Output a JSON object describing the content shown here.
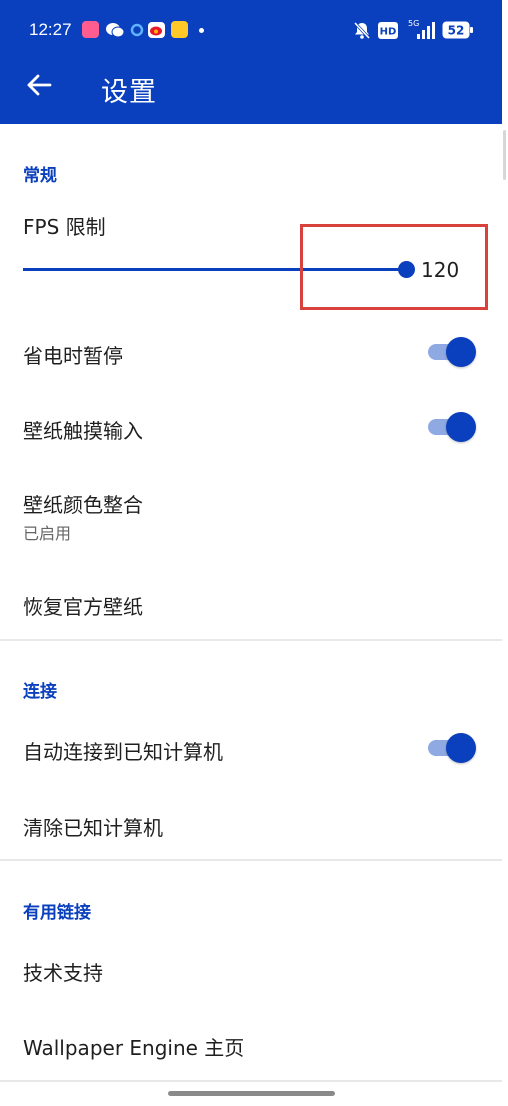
{
  "status_bar": {
    "time": "12:27",
    "network": "5G",
    "battery": "52",
    "hd_label": "HD"
  },
  "app_bar": {
    "title": "设置"
  },
  "sections": {
    "general": {
      "header": "常规",
      "fps": {
        "label": "FPS 限制",
        "value": "120",
        "slider_fraction": 1.0
      },
      "pause_on_battery_saver": {
        "label": "省电时暂停",
        "enabled": true
      },
      "wallpaper_touch_input": {
        "label": "壁纸触摸输入",
        "enabled": true
      },
      "wallpaper_color_integration": {
        "label": "壁纸颜色整合",
        "summary": "已启用"
      },
      "restore_official_wallpapers": {
        "label": "恢复官方壁纸"
      }
    },
    "connection": {
      "header": "连接",
      "auto_connect": {
        "label": "自动连接到已知计算机",
        "enabled": true
      },
      "clear_known": {
        "label": "清除已知计算机"
      }
    },
    "links": {
      "header": "有用链接",
      "support": {
        "label": "技术支持"
      },
      "homepage": {
        "label": "Wallpaper Engine 主页"
      }
    }
  },
  "colors": {
    "accent": "#0a3fbd",
    "switch_track": "#8fa9e3",
    "highlight": "#d9413c"
  }
}
